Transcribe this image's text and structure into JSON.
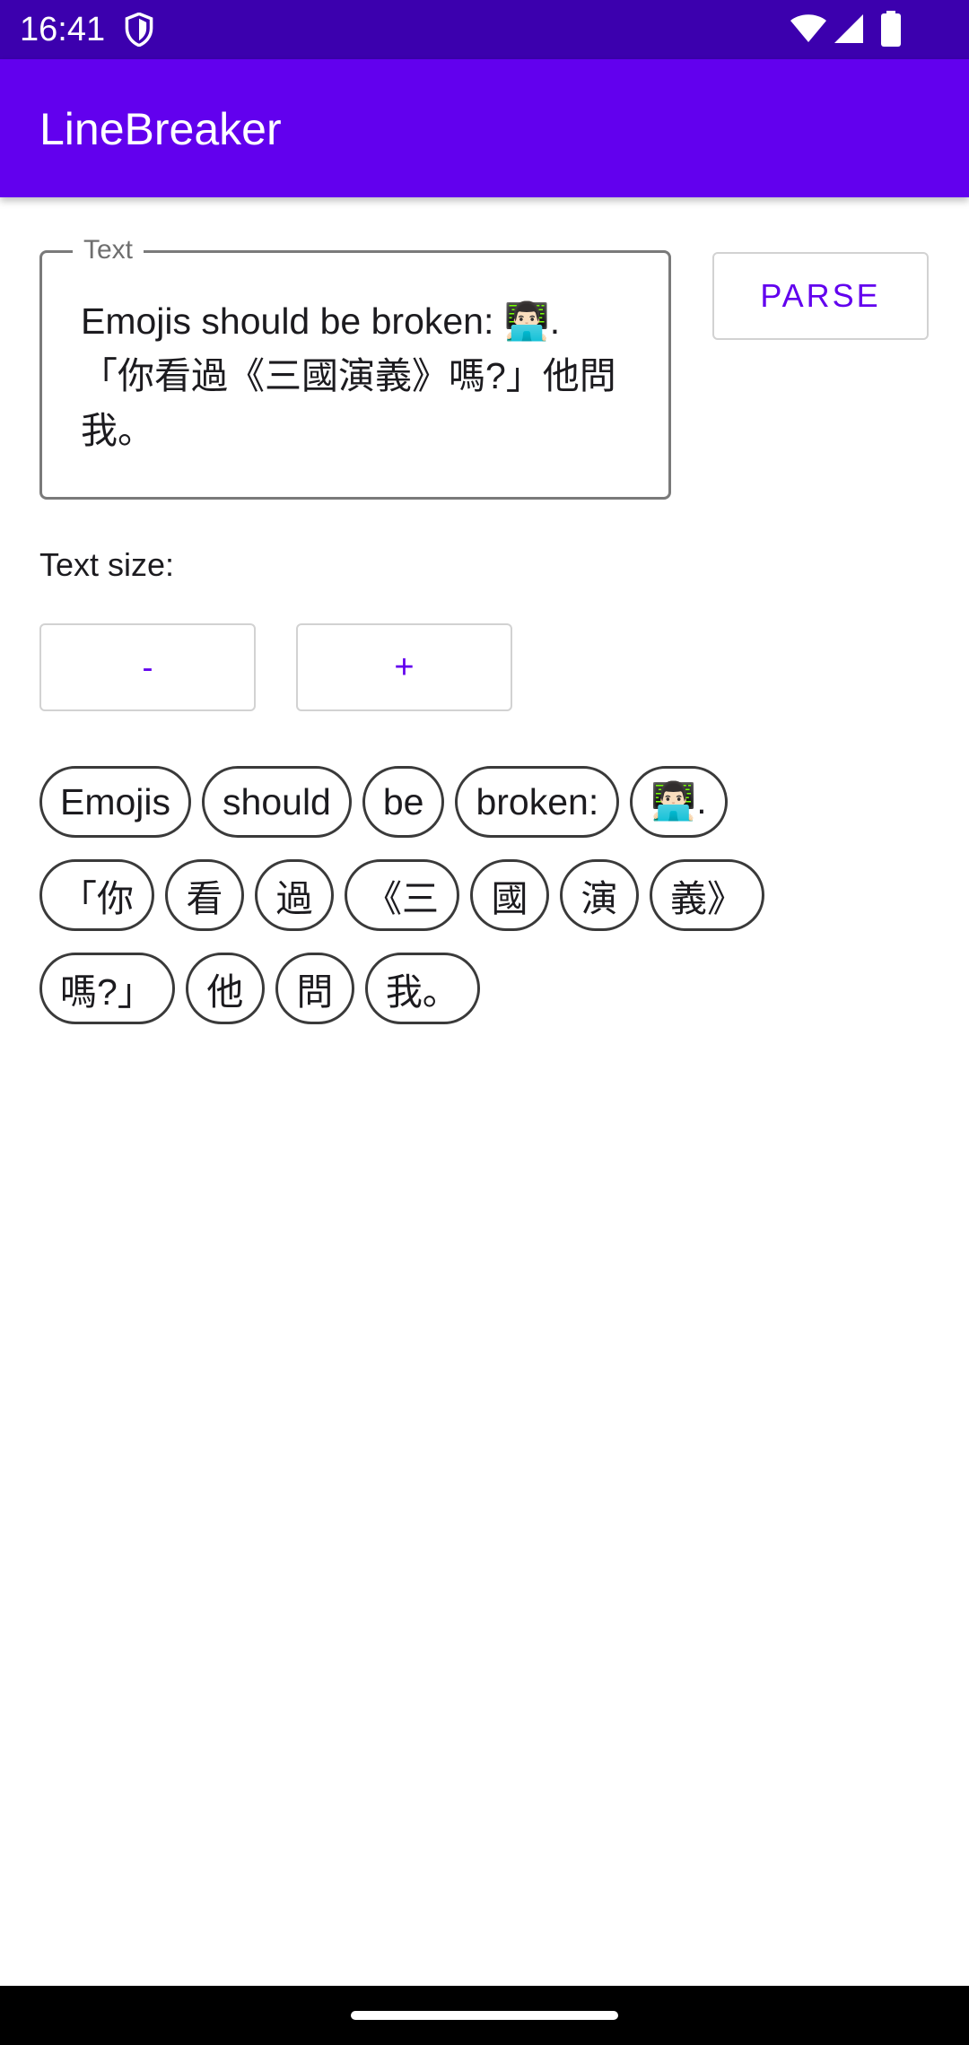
{
  "status_bar": {
    "time": "16:41",
    "icons": [
      "shield-icon",
      "wifi-icon",
      "signal-icon",
      "battery-icon"
    ]
  },
  "app_bar": {
    "title": "LineBreaker",
    "color": "#6200ee"
  },
  "text_field": {
    "label": "Text",
    "value": "Emojis should be broken: 👨🏻‍💻.\n「你看過《三國演義》嗎?」他問我。"
  },
  "buttons": {
    "parse": "PARSE",
    "decrease": "-",
    "increase": "+"
  },
  "text_size": {
    "label": "Text size:"
  },
  "chips": {
    "rows": [
      [
        "Emojis",
        "should",
        "be",
        "broken:",
        "👨🏻‍💻."
      ],
      [
        "「你",
        "看",
        "過",
        "《三",
        "國",
        "演",
        "義》"
      ],
      [
        "嗎?」",
        "他",
        "問",
        "我。"
      ]
    ]
  },
  "colors": {
    "status_bar": "#3c00ae",
    "accent": "#6200ee"
  }
}
